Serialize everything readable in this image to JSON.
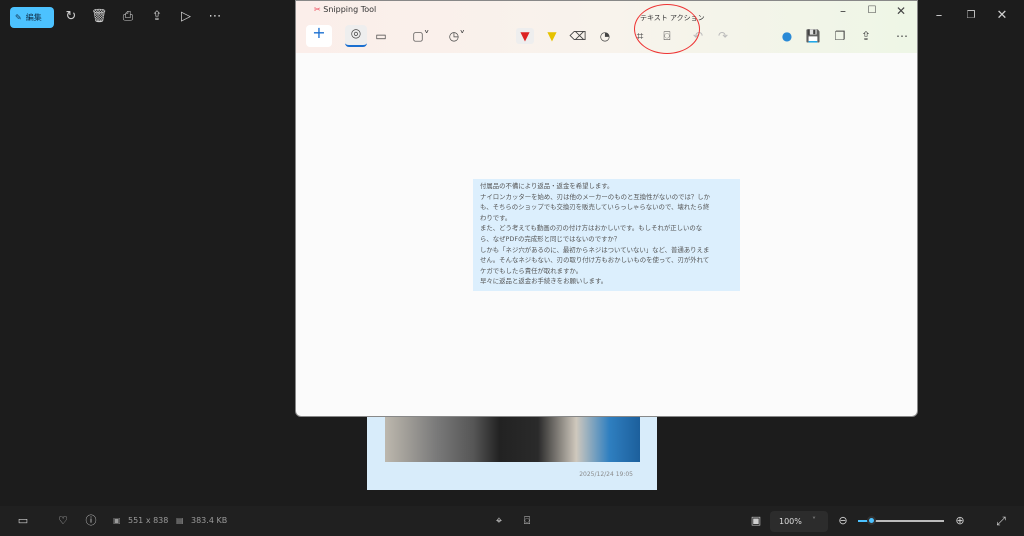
{
  "viewer": {
    "edit_label": "編集",
    "icons": [
      "rotate-icon",
      "delete-icon",
      "print-icon",
      "share-icon",
      "slideshow-icon",
      "more-icon"
    ],
    "window_controls": [
      "minimize-icon",
      "restore-icon",
      "close-icon"
    ]
  },
  "snipping_tool": {
    "title": "Snipping Tool",
    "tooltip": "テキスト アクション",
    "icons": [
      "new-icon",
      "screenshot-mode-icon",
      "video-mode-icon",
      "shape-dropdown-icon",
      "timer-dropdown-icon",
      "pen-icon",
      "highlighter-icon",
      "eraser-icon",
      "shapes-icon",
      "crop-icon",
      "text-actions-icon",
      "undo-icon",
      "redo-icon",
      "edit-in-paint-icon",
      "save-icon",
      "copy-icon",
      "share-icon",
      "more-icon"
    ]
  },
  "extracted_text": [
    "付属品の不備により返品・返金を希望します。",
    "ナイロンカッターを始め、刃は他のメーカーのものと互換性がないのでは？しか",
    "も、そちらのショップでも交換刃を販売していらっしゃらないので、壊れたら終",
    "わりです。",
    "また、どう考えても動画の刃の付け方はおかしいです。もしそれが正しいのな",
    "ら、なぜPDFの完成形と同じではないのですか？",
    "しかも「ネジ穴があるのに、最初からネジはついていない」など、普通ありえま",
    "せん。そんなネジもない、刃の取り付け方もおかしいものを使って、刃が外れて",
    "ケガでもしたら責任が取れますか。",
    "早々に返品と返金お手続きをお願いします。"
  ],
  "photo": {
    "timestamp": "2025/12/24 19:05"
  },
  "status": {
    "dimensions": "551 x 838",
    "file_size": "383.4 KB",
    "zoom": "100%",
    "zoom_level_fraction": 0.15
  },
  "colors": {
    "accent": "#4cc2ff",
    "annotation": "#e33333"
  }
}
